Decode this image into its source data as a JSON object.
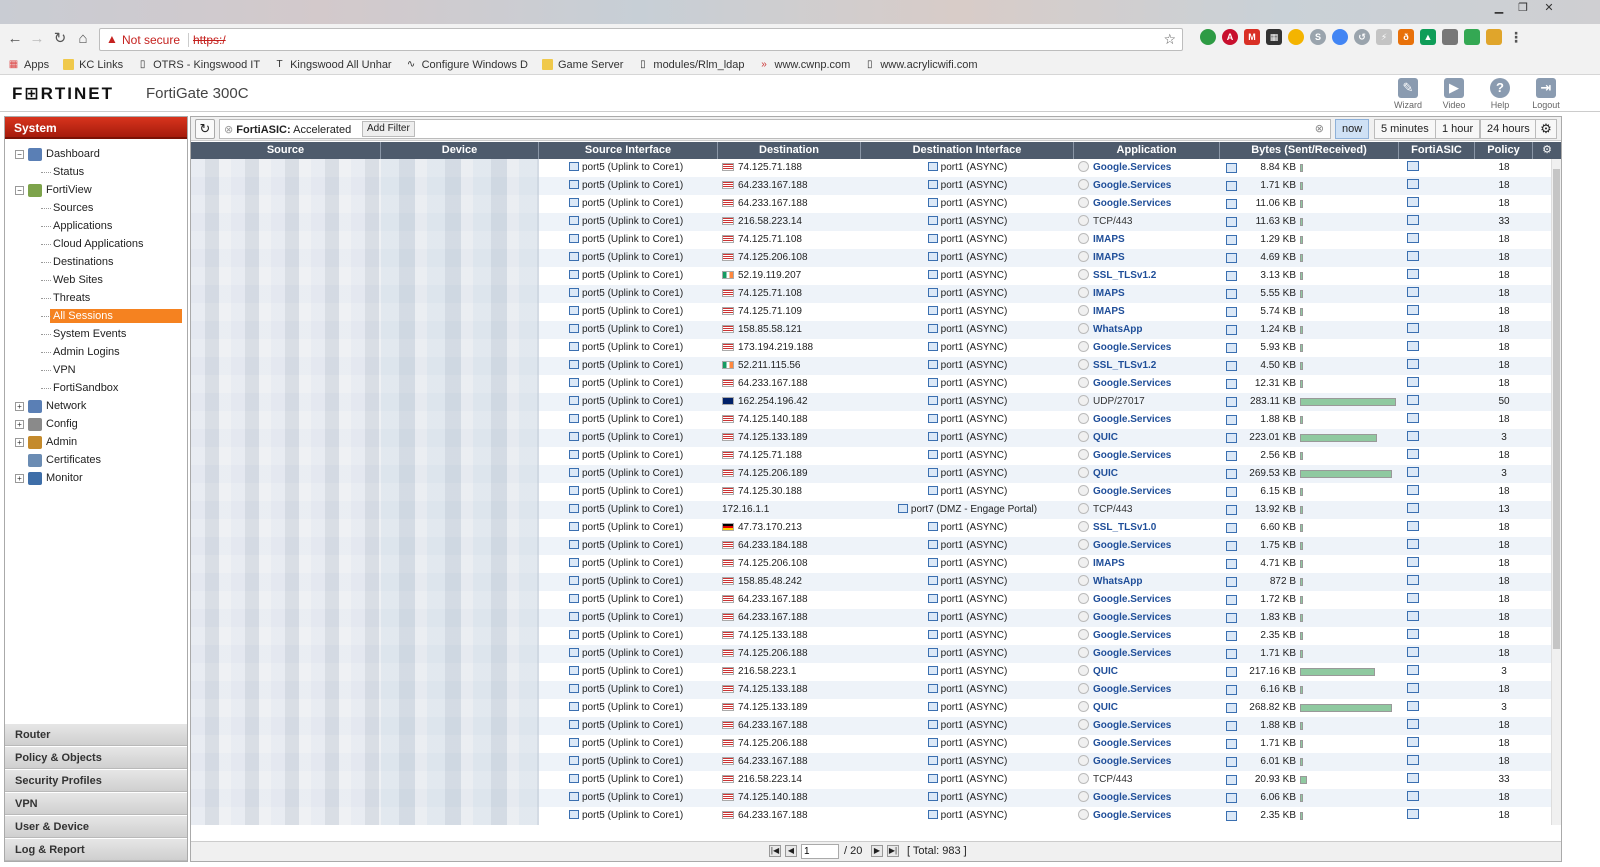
{
  "browser": {
    "not_secure": "Not secure",
    "url": "https:/",
    "bookmarks": [
      "Apps",
      "KC Links",
      "OTRS - Kingswood IT",
      "Kingswood All Unhar",
      "Configure Windows D",
      "Game Server",
      "modules/Rlm_ldap",
      "www.cwnp.com",
      "www.acrylicwifi.com"
    ]
  },
  "header": {
    "logo": "F⊞RTINET",
    "model": "FortiGate 300C",
    "buttons": [
      "Wizard",
      "Video",
      "Help",
      "Logout"
    ]
  },
  "sidebar": {
    "title": "System",
    "tree": [
      {
        "label": "Dashboard",
        "level": 0,
        "exp": "−"
      },
      {
        "label": "Status",
        "level": 1
      },
      {
        "label": "FortiView",
        "level": 0,
        "exp": "−"
      },
      {
        "label": "Sources",
        "level": 1
      },
      {
        "label": "Applications",
        "level": 1
      },
      {
        "label": "Cloud Applications",
        "level": 1
      },
      {
        "label": "Destinations",
        "level": 1
      },
      {
        "label": "Web Sites",
        "level": 1
      },
      {
        "label": "Threats",
        "level": 1
      },
      {
        "label": "All Sessions",
        "level": 1,
        "selected": true
      },
      {
        "label": "System Events",
        "level": 1
      },
      {
        "label": "Admin Logins",
        "level": 1
      },
      {
        "label": "VPN",
        "level": 1
      },
      {
        "label": "FortiSandbox",
        "level": 1
      },
      {
        "label": "Network",
        "level": 0,
        "exp": "+"
      },
      {
        "label": "Config",
        "level": 0,
        "exp": "+"
      },
      {
        "label": "Admin",
        "level": 0,
        "exp": "+"
      },
      {
        "label": "Certificates",
        "level": 0,
        "exp": ""
      },
      {
        "label": "Monitor",
        "level": 0,
        "exp": "+"
      }
    ],
    "bottom_nav": [
      "Router",
      "Policy & Objects",
      "Security Profiles",
      "VPN",
      "User & Device",
      "Log & Report"
    ]
  },
  "filter": {
    "key": "FortiASIC:",
    "value": "Accelerated",
    "add_filter": "Add Filter",
    "time_ranges": [
      "now",
      "5 minutes",
      "1 hour",
      "24 hours"
    ],
    "active_time": "now"
  },
  "table": {
    "columns": [
      "Source",
      "Device",
      "Source Interface",
      "Destination",
      "Destination Interface",
      "Application",
      "Bytes (Sent/Received)",
      "FortiASIC",
      "Policy"
    ],
    "rows": [
      [
        "port5 (Uplink to Core1)",
        "us",
        "74.125.71.188",
        "port1 (ASYNC)",
        "Google.Services",
        "8.84 KB",
        0.02,
        0,
        "18"
      ],
      [
        "port5 (Uplink to Core1)",
        "us",
        "64.233.167.188",
        "port1 (ASYNC)",
        "Google.Services",
        "1.71 KB",
        0.01,
        0,
        "18"
      ],
      [
        "port5 (Uplink to Core1)",
        "us",
        "64.233.167.188",
        "port1 (ASYNC)",
        "Google.Services",
        "11.06 KB",
        0.02,
        0,
        "18"
      ],
      [
        "port5 (Uplink to Core1)",
        "us",
        "216.58.223.14",
        "port1 (ASYNC)",
        "TCP/443",
        "11.63 KB",
        0.02,
        0,
        "33"
      ],
      [
        "port5 (Uplink to Core1)",
        "us",
        "74.125.71.108",
        "port1 (ASYNC)",
        "IMAPS",
        "1.29 KB",
        0.005,
        0,
        "18"
      ],
      [
        "port5 (Uplink to Core1)",
        "us",
        "74.125.206.108",
        "port1 (ASYNC)",
        "IMAPS",
        "4.69 KB",
        0.01,
        0,
        "18"
      ],
      [
        "port5 (Uplink to Core1)",
        "ie",
        "52.19.119.207",
        "port1 (ASYNC)",
        "SSL_TLSv1.2",
        "3.13 KB",
        0.01,
        0,
        "18"
      ],
      [
        "port5 (Uplink to Core1)",
        "us",
        "74.125.71.108",
        "port1 (ASYNC)",
        "IMAPS",
        "5.55 KB",
        0.01,
        0,
        "18"
      ],
      [
        "port5 (Uplink to Core1)",
        "us",
        "74.125.71.109",
        "port1 (ASYNC)",
        "IMAPS",
        "5.74 KB",
        0.01,
        0,
        "18"
      ],
      [
        "port5 (Uplink to Core1)",
        "us",
        "158.85.58.121",
        "port1 (ASYNC)",
        "WhatsApp",
        "1.24 KB",
        0.005,
        0,
        "18"
      ],
      [
        "port5 (Uplink to Core1)",
        "us",
        "173.194.219.188",
        "port1 (ASYNC)",
        "Google.Services",
        "5.93 KB",
        0.01,
        0,
        "18"
      ],
      [
        "port5 (Uplink to Core1)",
        "ie",
        "52.211.115.56",
        "port1 (ASYNC)",
        "SSL_TLSv1.2",
        "4.50 KB",
        0.01,
        0,
        "18"
      ],
      [
        "port5 (Uplink to Core1)",
        "us",
        "64.233.167.188",
        "port1 (ASYNC)",
        "Google.Services",
        "12.31 KB",
        0.02,
        0,
        "18"
      ],
      [
        "port5 (Uplink to Core1)",
        "gb",
        "162.254.196.42",
        "port1 (ASYNC)",
        "UDP/27017",
        "283.11 KB",
        1.0,
        0.78,
        "50"
      ],
      [
        "port5 (Uplink to Core1)",
        "us",
        "74.125.140.188",
        "port1 (ASYNC)",
        "Google.Services",
        "1.88 KB",
        0.01,
        0,
        "18"
      ],
      [
        "port5 (Uplink to Core1)",
        "us",
        "74.125.133.189",
        "port1 (ASYNC)",
        "QUIC",
        "223.01 KB",
        0.8,
        0.18,
        "3"
      ],
      [
        "port5 (Uplink to Core1)",
        "us",
        "74.125.71.188",
        "port1 (ASYNC)",
        "Google.Services",
        "2.56 KB",
        0.01,
        0,
        "18"
      ],
      [
        "port5 (Uplink to Core1)",
        "us",
        "74.125.206.189",
        "port1 (ASYNC)",
        "QUIC",
        "269.53 KB",
        0.96,
        0.35,
        "3"
      ],
      [
        "port5 (Uplink to Core1)",
        "us",
        "74.125.30.188",
        "port1 (ASYNC)",
        "Google.Services",
        "6.15 KB",
        0.01,
        0,
        "18"
      ],
      [
        "port5 (Uplink to Core1)",
        "",
        "172.16.1.1",
        "port7 (DMZ - Engage Portal)",
        "TCP/443",
        "13.92 KB",
        0.02,
        1,
        "13"
      ],
      [
        "port5 (Uplink to Core1)",
        "de",
        "47.73.170.213",
        "port1 (ASYNC)",
        "SSL_TLSv1.0",
        "6.60 KB",
        0.01,
        0,
        "18"
      ],
      [
        "port5 (Uplink to Core1)",
        "us",
        "64.233.184.188",
        "port1 (ASYNC)",
        "Google.Services",
        "1.75 KB",
        0.01,
        0,
        "18"
      ],
      [
        "port5 (Uplink to Core1)",
        "us",
        "74.125.206.108",
        "port1 (ASYNC)",
        "IMAPS",
        "4.71 KB",
        0.01,
        0,
        "18"
      ],
      [
        "port5 (Uplink to Core1)",
        "us",
        "158.85.48.242",
        "port1 (ASYNC)",
        "WhatsApp",
        "872 B",
        0.005,
        0,
        "18"
      ],
      [
        "port5 (Uplink to Core1)",
        "us",
        "64.233.167.188",
        "port1 (ASYNC)",
        "Google.Services",
        "1.72 KB",
        0.01,
        0,
        "18"
      ],
      [
        "port5 (Uplink to Core1)",
        "us",
        "64.233.167.188",
        "port1 (ASYNC)",
        "Google.Services",
        "1.83 KB",
        0.01,
        0,
        "18"
      ],
      [
        "port5 (Uplink to Core1)",
        "us",
        "74.125.133.188",
        "port1 (ASYNC)",
        "Google.Services",
        "2.35 KB",
        0.01,
        0,
        "18"
      ],
      [
        "port5 (Uplink to Core1)",
        "us",
        "74.125.206.188",
        "port1 (ASYNC)",
        "Google.Services",
        "1.71 KB",
        0.01,
        0,
        "18"
      ],
      [
        "port5 (Uplink to Core1)",
        "us",
        "216.58.223.1",
        "port1 (ASYNC)",
        "QUIC",
        "217.16 KB",
        0.78,
        0,
        "3"
      ],
      [
        "port5 (Uplink to Core1)",
        "us",
        "74.125.133.188",
        "port1 (ASYNC)",
        "Google.Services",
        "6.16 KB",
        0.01,
        0,
        "18"
      ],
      [
        "port5 (Uplink to Core1)",
        "us",
        "74.125.133.189",
        "port1 (ASYNC)",
        "QUIC",
        "268.82 KB",
        0.96,
        0.55,
        "3"
      ],
      [
        "port5 (Uplink to Core1)",
        "us",
        "64.233.167.188",
        "port1 (ASYNC)",
        "Google.Services",
        "1.88 KB",
        0.01,
        0,
        "18"
      ],
      [
        "port5 (Uplink to Core1)",
        "us",
        "74.125.206.188",
        "port1 (ASYNC)",
        "Google.Services",
        "1.71 KB",
        0.01,
        0,
        "18"
      ],
      [
        "port5 (Uplink to Core1)",
        "us",
        "64.233.167.188",
        "port1 (ASYNC)",
        "Google.Services",
        "6.01 KB",
        0.01,
        0,
        "18"
      ],
      [
        "port5 (Uplink to Core1)",
        "us",
        "216.58.223.14",
        "port1 (ASYNC)",
        "TCP/443",
        "20.93 KB",
        0.07,
        0,
        "33"
      ],
      [
        "port5 (Uplink to Core1)",
        "us",
        "74.125.140.188",
        "port1 (ASYNC)",
        "Google.Services",
        "6.06 KB",
        0.01,
        0,
        "18"
      ],
      [
        "port5 (Uplink to Core1)",
        "us",
        "64.233.167.188",
        "port1 (ASYNC)",
        "Google.Services",
        "2.35 KB",
        0.01,
        0,
        "18"
      ]
    ]
  },
  "pager": {
    "page": "1",
    "of": "/ 20",
    "total": "[ Total: 983 ]"
  }
}
